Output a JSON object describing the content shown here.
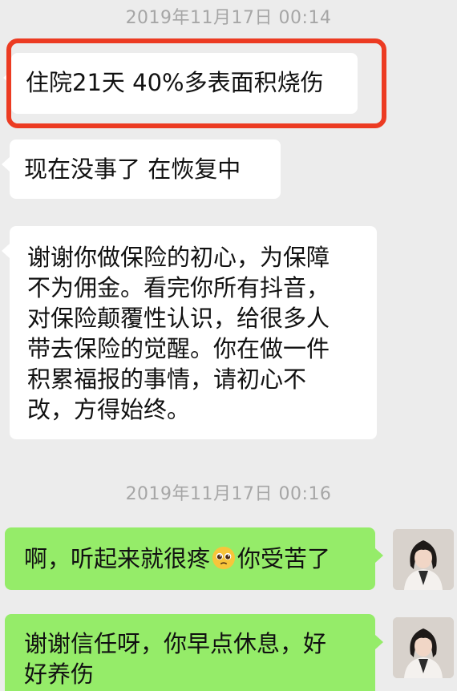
{
  "timestamps": [
    "2019年11月17日 00:14",
    "2019年11月17日 00:16"
  ],
  "messages": {
    "in1": "住院21天 40%多表面积烧伤",
    "in2": "现在没事了 在恢复中",
    "in3_lines": [
      "谢谢你做保险的初心，为保障",
      "不为佣金。看完你所有抖音，",
      "对保险颠覆性认识，给很多人",
      "带去保险的觉醒。你在做一件",
      "积累福报的事情，请初心不",
      "改，方得始终。"
    ],
    "out1_before": "啊，听起来就很疼",
    "out1_emoji": "pleading-face-emoji",
    "out1_after": "你受苦了",
    "out2_lines": [
      "谢谢信任呀，你早点休息，好",
      "好养伤"
    ]
  },
  "colors": {
    "background": "#ececec",
    "incoming_bubble": "#ffffff",
    "outgoing_bubble": "#95ec69",
    "highlight_border": "#ec3b22",
    "timestamp_text": "#a6a6a6"
  }
}
